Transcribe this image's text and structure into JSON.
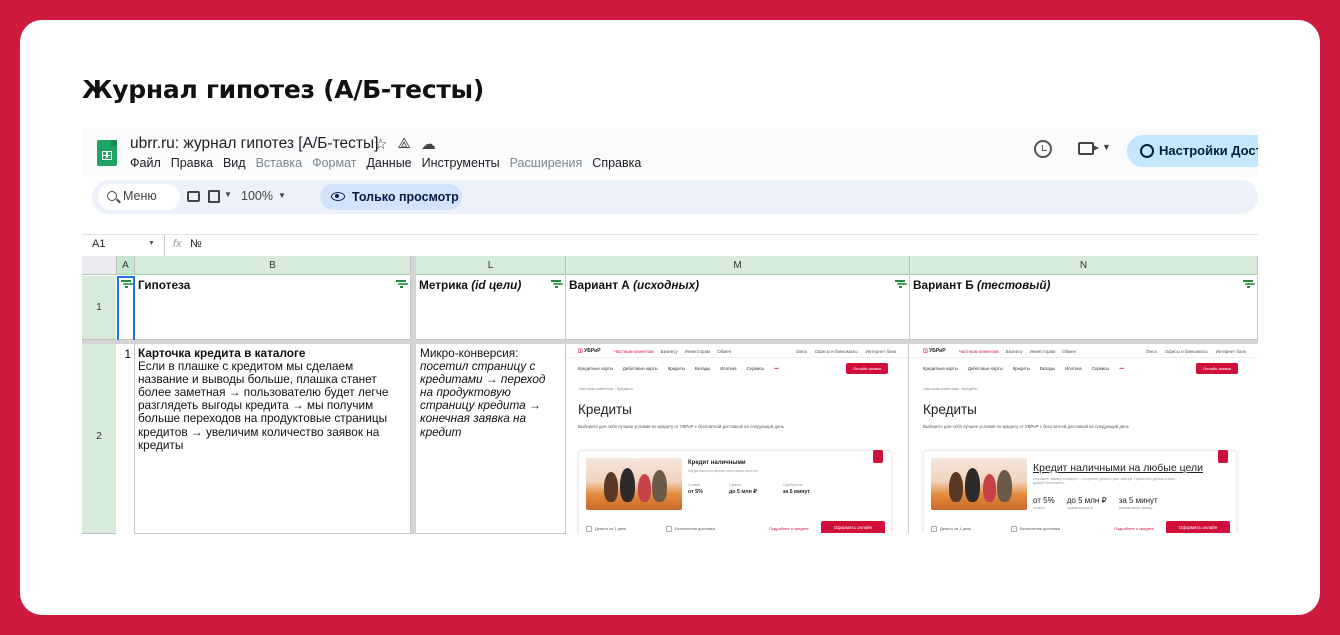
{
  "slide_title": "Журнал гипотез (А/Б-тесты)",
  "app": {
    "doc_title": "ubrr.ru: журнал гипотез [А/Б-тесты]",
    "title_icons": [
      "star-icon",
      "move-icon",
      "cloud-status-icon"
    ],
    "menu": [
      {
        "label": "Файл",
        "disabled": false
      },
      {
        "label": "Правка",
        "disabled": false
      },
      {
        "label": "Вид",
        "disabled": false
      },
      {
        "label": "Вставка",
        "disabled": true
      },
      {
        "label": "Формат",
        "disabled": true
      },
      {
        "label": "Данные",
        "disabled": false
      },
      {
        "label": "Инструменты",
        "disabled": false
      },
      {
        "label": "Расширения",
        "disabled": true
      },
      {
        "label": "Справка",
        "disabled": false
      }
    ],
    "share_label": "Настройки Доступа"
  },
  "toolbar": {
    "search_label": "Меню",
    "zoom": "100%",
    "view_only_label": "Только просмотр"
  },
  "formula_bar": {
    "cell_ref": "A1",
    "fx": "fx",
    "formula": "№"
  },
  "columns": [
    "A",
    "B",
    "L",
    "M",
    "N"
  ],
  "rows": [
    "1",
    "2"
  ],
  "headers": {
    "b": "Гипотеза",
    "l_plain": "Метрика ",
    "l_italic": "(id цели)",
    "m_plain": "Вариант А ",
    "m_italic": "(исходных)",
    "n_plain": "Вариант Б ",
    "n_italic": "(тестовый)"
  },
  "row2": {
    "num": "1",
    "hypothesis_title": "Карточка кредита в каталоге",
    "hypothesis_text": "Если в плашке с кредитом мы сделаем название и выводы больше, плашка станет более заметная → пользователю будет легче разглядеть выгоды кредита → мы получим больше переходов на продуктовые страницы кредитов → увеличим количество заявок на кредиты",
    "metric_plain": "Микро-конверсия: ",
    "metric_italic": "посетил страницу с кредитами → переход на продуктовую страницу кредита → конечная заявка на кредит"
  },
  "bank_common": {
    "logo": "УБРиР",
    "top_tabs": [
      "Частным клиентам",
      "Бизнесу",
      "Инвесторам",
      "Обмен"
    ],
    "top_right": [
      "Омск",
      "Офисы и банкоматы",
      "Интернет банк"
    ],
    "menu": [
      "Кредитные карты",
      "Дебетовые карты",
      "Кредиты",
      "Вклады",
      "Ипотека",
      "Сервисы",
      "•••"
    ],
    "online_btn": "Онлайн-заявка",
    "crumb": "Частным клиентам  ›  Кредиты",
    "h1": "Кредиты",
    "sub": "Выберите для себя лучшие условия по кредиту от УБРиР с бесплатной доставкой на следующий день",
    "foot1": "Деньги за 1 день",
    "foot2": "Бесплатная доставка",
    "more": "Подробнее о кредите",
    "apply": "Оформить онлайн"
  },
  "variant_a": {
    "card_title": "Кредит наличными",
    "card_sub": "Когда настало время исполнить мечты!",
    "stats": [
      {
        "label": "Ставка",
        "value": "от 5%"
      },
      {
        "label": "Сумма",
        "value": "до 5 млн ₽"
      },
      {
        "label": "Одобрение",
        "value": "за 5 минут"
      }
    ]
  },
  "variant_b": {
    "card_title": "Кредит наличными на любые цели",
    "card_sub": "Оставьте заявку сегодня — получите деньги уже завтра. Привезём деньги к вам домой бесплатно.",
    "stats": [
      {
        "label": "ставка",
        "value": "от 5%"
      },
      {
        "label": "сумма кредита",
        "value": "до 5 млн ₽"
      },
      {
        "label": "рассмотрим заявку",
        "value": "за 5 минут"
      }
    ]
  },
  "colors": {
    "background": "#cf1a3f",
    "sheets_green": "#1fa463",
    "header_green": "#d7ebdb",
    "bank_red": "#d0103a",
    "share_blue": "#c2e7ff"
  }
}
